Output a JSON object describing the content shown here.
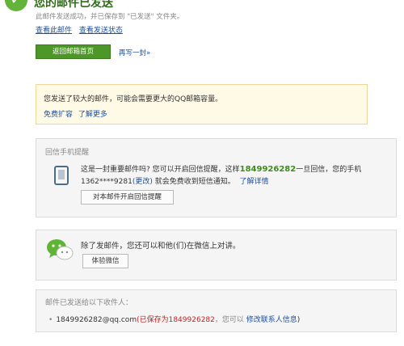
{
  "header": {
    "title": "您的邮件已发送",
    "subtitle": "此邮件发送成功，并已保存到 \"已发送\" 文件夹。",
    "view_mail_link": "查看此邮件",
    "view_status_link": "查看发送状态"
  },
  "actions": {
    "back_button": "返回邮箱首页",
    "rewrite_link": "再写一封»"
  },
  "storage_notice": {
    "message": "您发送了较大的邮件，可能会需要更大的QQ邮箱容量。",
    "expand_link": "免费扩容",
    "learn_more_link": "了解更多"
  },
  "sms_reminder": {
    "title": "回信手机提醒",
    "text_before": "这是一封重要邮件吗? 您可以开启回信提醒，这样",
    "email_number": "1849926282",
    "text_after": "一旦回信，您的手机",
    "phone_masked": "1362****9281",
    "change_link": "(更改)",
    "text_free": " 就会免费收到短信通知。",
    "details_link": "了解详情",
    "enable_button": "对本邮件开启回信提醒"
  },
  "wechat": {
    "message": "除了发邮件，您还可以和他(们)在微信上对讲。",
    "button": "体验微信"
  },
  "recipients": {
    "title": "邮件已发送给以下收件人：",
    "items": [
      {
        "email": "1849926282@qq.com",
        "saved_prefix": "(已保存为",
        "saved_name": "1849926282",
        "saved_suffix": "，您可以",
        "modify_link": "修改联系人信息",
        "close_paren": ")"
      }
    ]
  },
  "colors": {
    "brand_green": "#4d9628",
    "title_green": "#2f6b19",
    "link_blue": "#1e50a2",
    "notice_bg": "#fffae6",
    "panel_bg": "#f5f5f5",
    "red": "#c62424"
  },
  "icons": {
    "success": "check-circle-icon",
    "phone": "phone-icon",
    "wechat": "wechat-icon"
  }
}
